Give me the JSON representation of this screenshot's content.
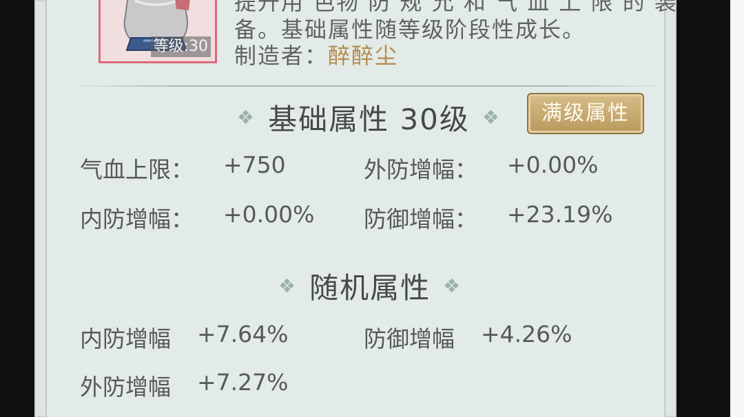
{
  "item": {
    "level_badge": "等级:30",
    "description_line1": "提升用 色物 防 规 允 和 气 血 上 限 的 装",
    "description_line2": "备。基础属性随等级阶段性成长。",
    "maker_label": "制造者：",
    "maker_name": "醉醉尘"
  },
  "base_section": {
    "title": "基础属性  30级",
    "full_level_button": "满级属性",
    "stats": [
      {
        "label": "气血上限：",
        "value": "+750"
      },
      {
        "label": "外防增幅：",
        "value": "+0.00%"
      },
      {
        "label": "内防增幅：",
        "value": "+0.00%"
      },
      {
        "label": "防御增幅：",
        "value": "+23.19%"
      }
    ]
  },
  "random_section": {
    "title": "随机属性",
    "stats": [
      {
        "label": "内防增幅",
        "value": "+7.64%"
      },
      {
        "label": "防御增幅",
        "value": "+4.26%"
      },
      {
        "label": "外防增幅",
        "value": "+7.27%"
      }
    ]
  },
  "icons": {
    "diamond": "❖",
    "helmet": "helmet-icon"
  },
  "colors": {
    "panel_bg": "#e3ebe8",
    "maker_name": "#b38a4c",
    "item_border": "#d86a7c",
    "button_gold": "#c9ab6e"
  }
}
